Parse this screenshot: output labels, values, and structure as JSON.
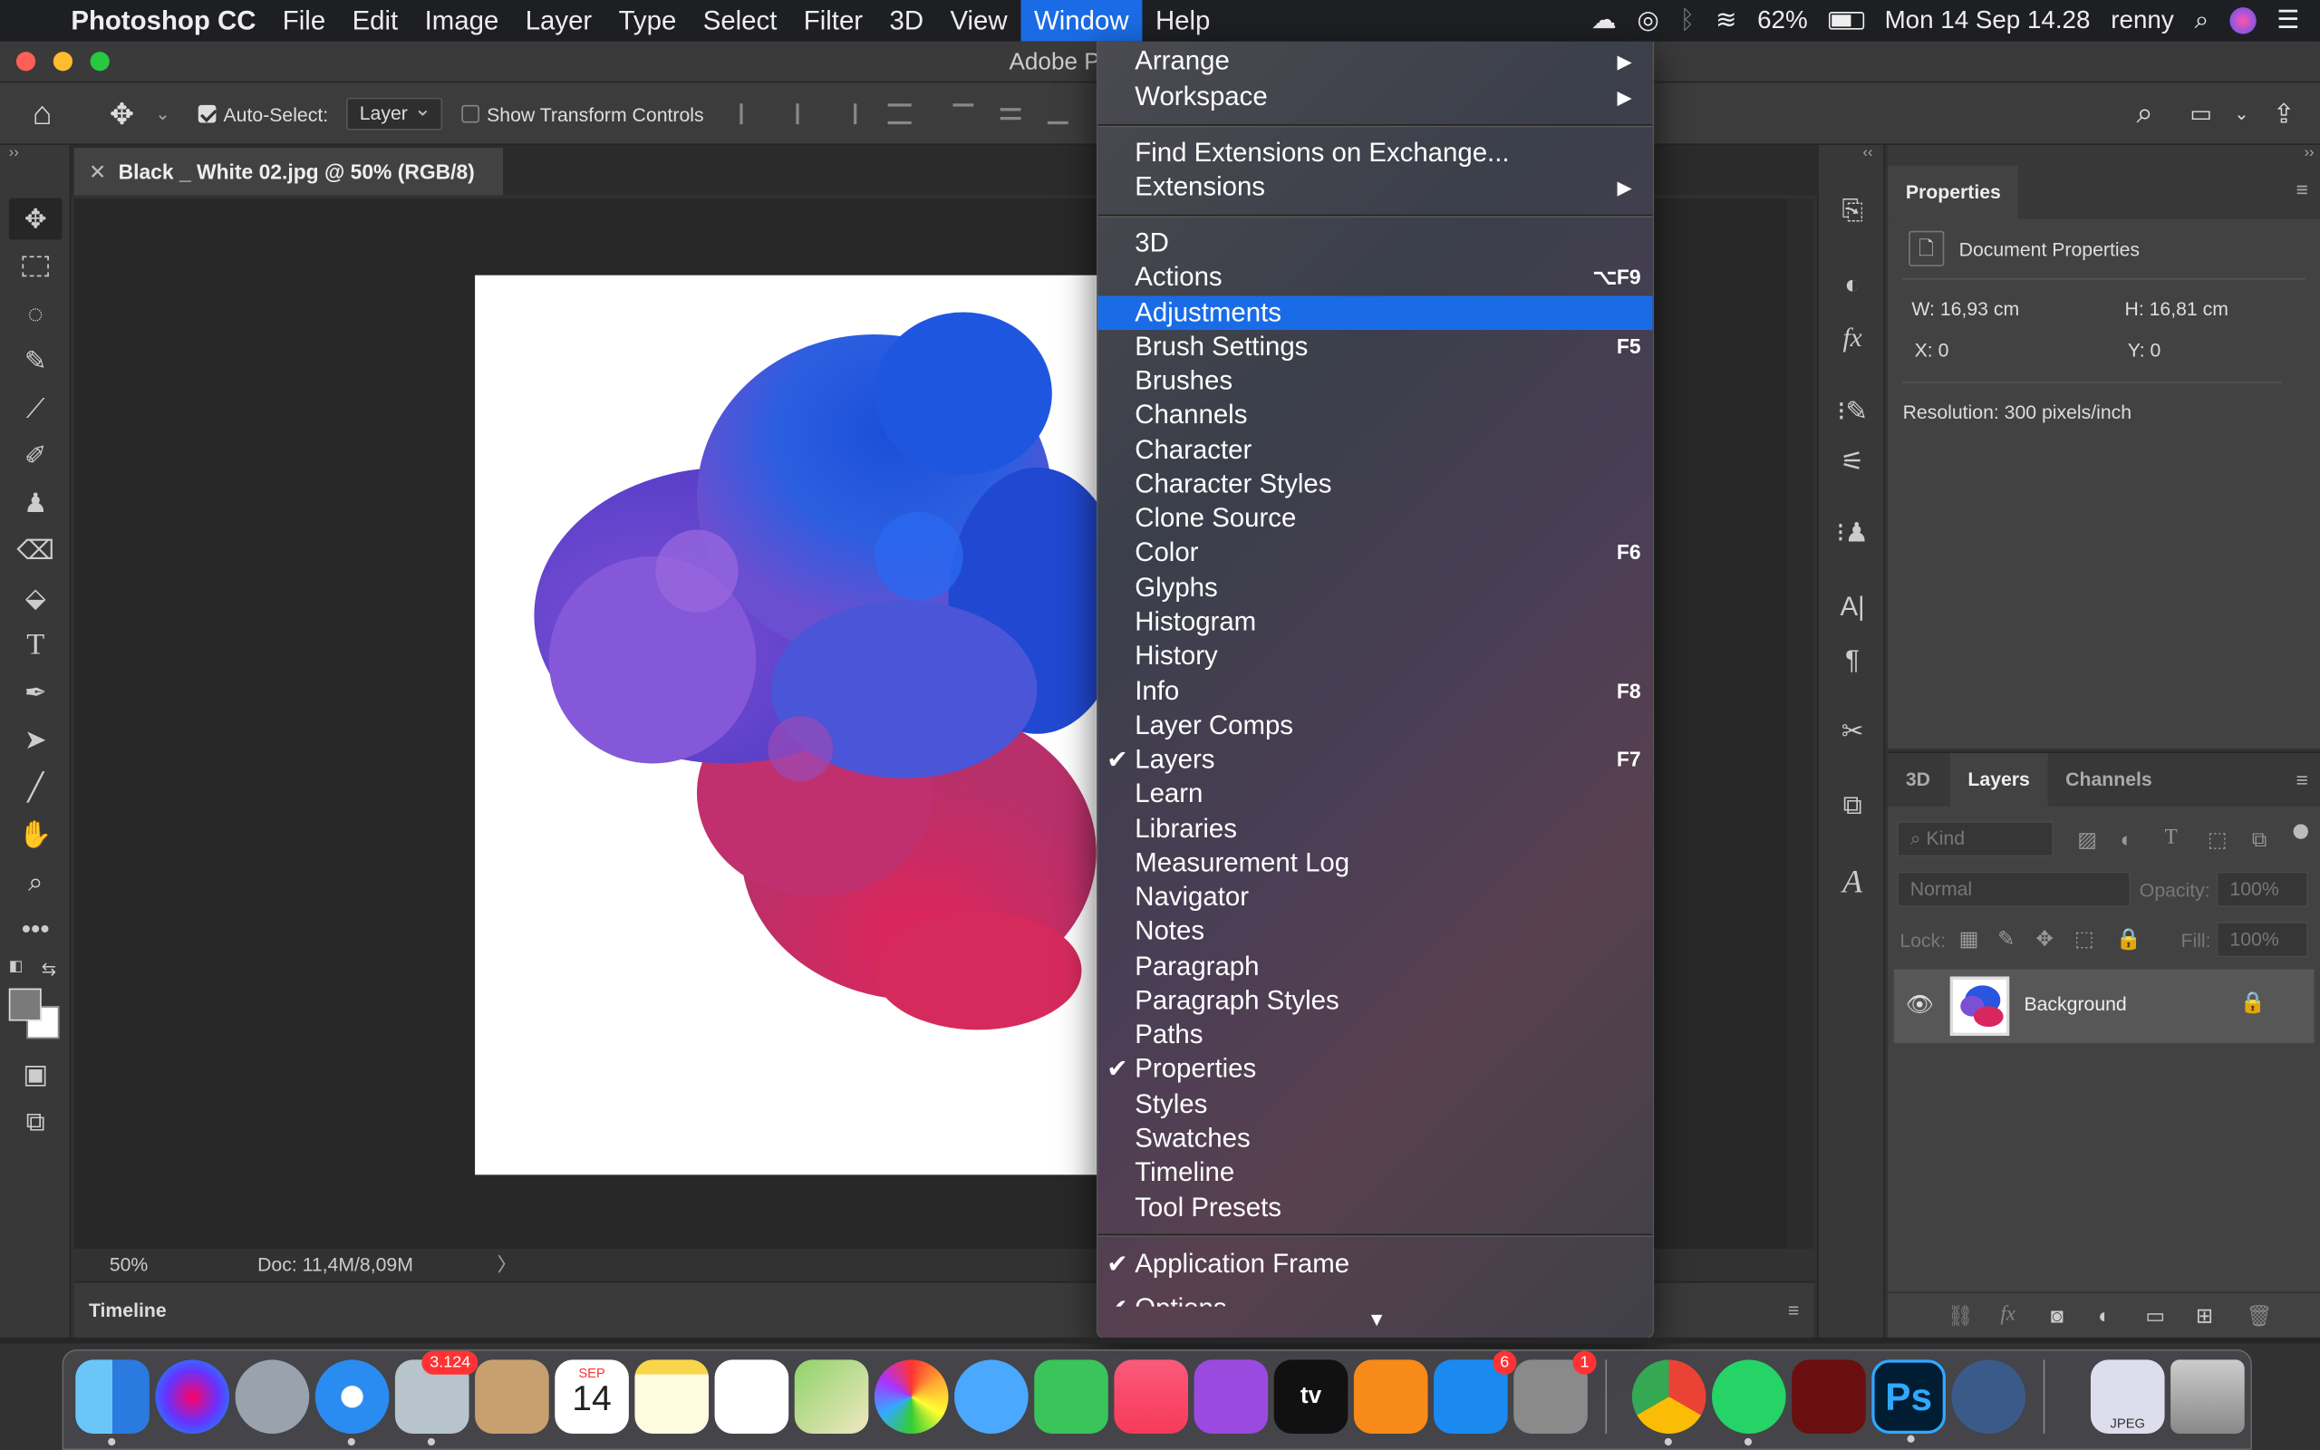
{
  "menubar": {
    "apple": "",
    "app_name": "Photoshop CC",
    "items": [
      "File",
      "Edit",
      "Image",
      "Layer",
      "Type",
      "Select",
      "Filter",
      "3D",
      "View",
      "Window",
      "Help"
    ],
    "active": "Window",
    "battery": "62%",
    "datetime": "Mon 14 Sep  14.28",
    "user": "renny"
  },
  "titlebar": {
    "title": "Adobe P"
  },
  "options": {
    "auto_select_label": "Auto-Select:",
    "auto_select_value": "Layer",
    "transform_label": "Show Transform Controls"
  },
  "document": {
    "tab_title": "Black _ White 02.jpg @ 50% (RGB/8)",
    "zoom": "50%",
    "doc_info": "Doc: 11,4M/8,09M",
    "timeline_label": "Timeline"
  },
  "properties": {
    "tab": "Properties",
    "section": "Document Properties",
    "w": "W: 16,93 cm",
    "h": "H: 16,81 cm",
    "x": "X: 0",
    "y": "Y: 0",
    "resolution": "Resolution: 300 pixels/inch"
  },
  "layers": {
    "tabs": [
      "3D",
      "Layers",
      "Channels"
    ],
    "active_tab": "Layers",
    "kind_placeholder": "Kind",
    "blend_mode": "Normal",
    "opacity_label": "Opacity:",
    "opacity_value": "100%",
    "lock_label": "Lock:",
    "fill_label": "Fill:",
    "fill_value": "100%",
    "layer_name": "Background"
  },
  "window_menu": {
    "arrange": "Arrange",
    "workspace": "Workspace",
    "find_ext": "Find Extensions on Exchange...",
    "extensions": "Extensions",
    "items": [
      {
        "label": "3D",
        "shortcut": "",
        "checked": false
      },
      {
        "label": "Actions",
        "shortcut": "⌥F9",
        "checked": false
      },
      {
        "label": "Adjustments",
        "shortcut": "",
        "checked": false,
        "highlight": true
      },
      {
        "label": "Brush Settings",
        "shortcut": "F5",
        "checked": false
      },
      {
        "label": "Brushes",
        "shortcut": "",
        "checked": false
      },
      {
        "label": "Channels",
        "shortcut": "",
        "checked": false
      },
      {
        "label": "Character",
        "shortcut": "",
        "checked": false
      },
      {
        "label": "Character Styles",
        "shortcut": "",
        "checked": false
      },
      {
        "label": "Clone Source",
        "shortcut": "",
        "checked": false
      },
      {
        "label": "Color",
        "shortcut": "F6",
        "checked": false
      },
      {
        "label": "Glyphs",
        "shortcut": "",
        "checked": false
      },
      {
        "label": "Histogram",
        "shortcut": "",
        "checked": false
      },
      {
        "label": "History",
        "shortcut": "",
        "checked": false
      },
      {
        "label": "Info",
        "shortcut": "F8",
        "checked": false
      },
      {
        "label": "Layer Comps",
        "shortcut": "",
        "checked": false
      },
      {
        "label": "Layers",
        "shortcut": "F7",
        "checked": true
      },
      {
        "label": "Learn",
        "shortcut": "",
        "checked": false
      },
      {
        "label": "Libraries",
        "shortcut": "",
        "checked": false
      },
      {
        "label": "Measurement Log",
        "shortcut": "",
        "checked": false
      },
      {
        "label": "Navigator",
        "shortcut": "",
        "checked": false
      },
      {
        "label": "Notes",
        "shortcut": "",
        "checked": false
      },
      {
        "label": "Paragraph",
        "shortcut": "",
        "checked": false
      },
      {
        "label": "Paragraph Styles",
        "shortcut": "",
        "checked": false
      },
      {
        "label": "Paths",
        "shortcut": "",
        "checked": false
      },
      {
        "label": "Properties",
        "shortcut": "",
        "checked": true
      },
      {
        "label": "Styles",
        "shortcut": "",
        "checked": false
      },
      {
        "label": "Swatches",
        "shortcut": "",
        "checked": false
      },
      {
        "label": "Timeline",
        "shortcut": "",
        "checked": false
      },
      {
        "label": "Tool Presets",
        "shortcut": "",
        "checked": false
      }
    ],
    "app_frame": "Application Frame",
    "options_partial": "Options"
  },
  "dock": {
    "badge_photos": "3.124",
    "calendar_month": "SEP",
    "calendar_day": "14",
    "badge_appstore": "6",
    "badge_prefs": "1",
    "ps_label": "Ps",
    "jpeg_label": "JPEG",
    "appletv_label": "tv"
  },
  "colors": {
    "accent": "#1a6ce6",
    "menubar": "#1e1f23",
    "panel": "#383838"
  }
}
